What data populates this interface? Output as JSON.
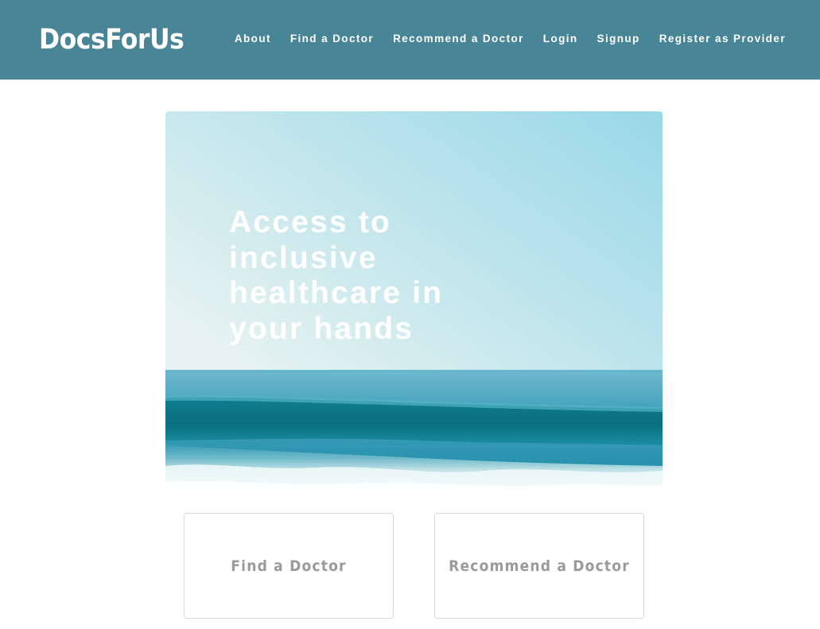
{
  "header": {
    "brand": "DocsForUs",
    "nav": [
      {
        "label": "About"
      },
      {
        "label": "Find a Doctor"
      },
      {
        "label": "Recommend a Doctor"
      },
      {
        "label": "Login"
      },
      {
        "label": "Signup"
      },
      {
        "label": "Register as Provider"
      }
    ]
  },
  "hero": {
    "title": "Access to inclusive healthcare in your hands"
  },
  "cards": [
    {
      "label": "Find a Doctor"
    },
    {
      "label": "Recommend a Doctor"
    }
  ],
  "colors": {
    "header_background": "#478597",
    "card_border": "#d9d9d9",
    "card_text": "#9a9a9a"
  }
}
